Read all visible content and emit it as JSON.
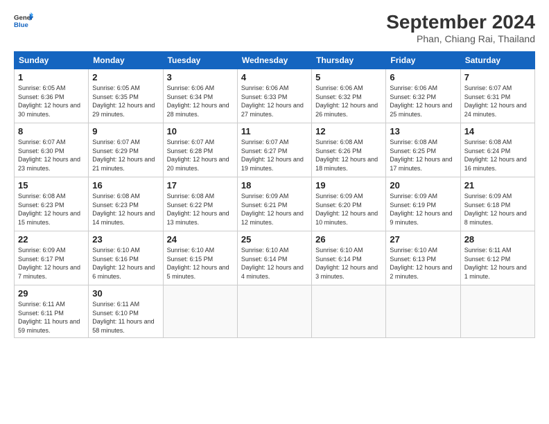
{
  "header": {
    "logo_line1": "General",
    "logo_line2": "Blue",
    "month": "September 2024",
    "location": "Phan, Chiang Rai, Thailand"
  },
  "weekdays": [
    "Sunday",
    "Monday",
    "Tuesday",
    "Wednesday",
    "Thursday",
    "Friday",
    "Saturday"
  ],
  "weeks": [
    [
      {
        "day": "1",
        "sunrise": "6:05 AM",
        "sunset": "6:36 PM",
        "daylight": "12 hours and 30 minutes."
      },
      {
        "day": "2",
        "sunrise": "6:05 AM",
        "sunset": "6:35 PM",
        "daylight": "12 hours and 29 minutes."
      },
      {
        "day": "3",
        "sunrise": "6:06 AM",
        "sunset": "6:34 PM",
        "daylight": "12 hours and 28 minutes."
      },
      {
        "day": "4",
        "sunrise": "6:06 AM",
        "sunset": "6:33 PM",
        "daylight": "12 hours and 27 minutes."
      },
      {
        "day": "5",
        "sunrise": "6:06 AM",
        "sunset": "6:32 PM",
        "daylight": "12 hours and 26 minutes."
      },
      {
        "day": "6",
        "sunrise": "6:06 AM",
        "sunset": "6:32 PM",
        "daylight": "12 hours and 25 minutes."
      },
      {
        "day": "7",
        "sunrise": "6:07 AM",
        "sunset": "6:31 PM",
        "daylight": "12 hours and 24 minutes."
      }
    ],
    [
      {
        "day": "8",
        "sunrise": "6:07 AM",
        "sunset": "6:30 PM",
        "daylight": "12 hours and 23 minutes."
      },
      {
        "day": "9",
        "sunrise": "6:07 AM",
        "sunset": "6:29 PM",
        "daylight": "12 hours and 21 minutes."
      },
      {
        "day": "10",
        "sunrise": "6:07 AM",
        "sunset": "6:28 PM",
        "daylight": "12 hours and 20 minutes."
      },
      {
        "day": "11",
        "sunrise": "6:07 AM",
        "sunset": "6:27 PM",
        "daylight": "12 hours and 19 minutes."
      },
      {
        "day": "12",
        "sunrise": "6:08 AM",
        "sunset": "6:26 PM",
        "daylight": "12 hours and 18 minutes."
      },
      {
        "day": "13",
        "sunrise": "6:08 AM",
        "sunset": "6:25 PM",
        "daylight": "12 hours and 17 minutes."
      },
      {
        "day": "14",
        "sunrise": "6:08 AM",
        "sunset": "6:24 PM",
        "daylight": "12 hours and 16 minutes."
      }
    ],
    [
      {
        "day": "15",
        "sunrise": "6:08 AM",
        "sunset": "6:23 PM",
        "daylight": "12 hours and 15 minutes."
      },
      {
        "day": "16",
        "sunrise": "6:08 AM",
        "sunset": "6:23 PM",
        "daylight": "12 hours and 14 minutes."
      },
      {
        "day": "17",
        "sunrise": "6:08 AM",
        "sunset": "6:22 PM",
        "daylight": "12 hours and 13 minutes."
      },
      {
        "day": "18",
        "sunrise": "6:09 AM",
        "sunset": "6:21 PM",
        "daylight": "12 hours and 12 minutes."
      },
      {
        "day": "19",
        "sunrise": "6:09 AM",
        "sunset": "6:20 PM",
        "daylight": "12 hours and 10 minutes."
      },
      {
        "day": "20",
        "sunrise": "6:09 AM",
        "sunset": "6:19 PM",
        "daylight": "12 hours and 9 minutes."
      },
      {
        "day": "21",
        "sunrise": "6:09 AM",
        "sunset": "6:18 PM",
        "daylight": "12 hours and 8 minutes."
      }
    ],
    [
      {
        "day": "22",
        "sunrise": "6:09 AM",
        "sunset": "6:17 PM",
        "daylight": "12 hours and 7 minutes."
      },
      {
        "day": "23",
        "sunrise": "6:10 AM",
        "sunset": "6:16 PM",
        "daylight": "12 hours and 6 minutes."
      },
      {
        "day": "24",
        "sunrise": "6:10 AM",
        "sunset": "6:15 PM",
        "daylight": "12 hours and 5 minutes."
      },
      {
        "day": "25",
        "sunrise": "6:10 AM",
        "sunset": "6:14 PM",
        "daylight": "12 hours and 4 minutes."
      },
      {
        "day": "26",
        "sunrise": "6:10 AM",
        "sunset": "6:14 PM",
        "daylight": "12 hours and 3 minutes."
      },
      {
        "day": "27",
        "sunrise": "6:10 AM",
        "sunset": "6:13 PM",
        "daylight": "12 hours and 2 minutes."
      },
      {
        "day": "28",
        "sunrise": "6:11 AM",
        "sunset": "6:12 PM",
        "daylight": "12 hours and 1 minute."
      }
    ],
    [
      {
        "day": "29",
        "sunrise": "6:11 AM",
        "sunset": "6:11 PM",
        "daylight": "11 hours and 59 minutes."
      },
      {
        "day": "30",
        "sunrise": "6:11 AM",
        "sunset": "6:10 PM",
        "daylight": "11 hours and 58 minutes."
      },
      null,
      null,
      null,
      null,
      null
    ]
  ]
}
